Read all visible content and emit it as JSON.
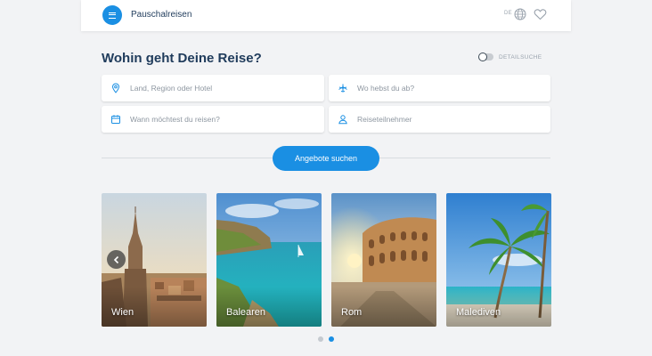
{
  "header": {
    "brand": "Pauschalreisen",
    "language": "DE",
    "icons": [
      "menu-icon",
      "globe-icon",
      "heart-icon"
    ]
  },
  "search": {
    "headline": "Wohin geht Deine Reise?",
    "detail_toggle_label": "DETAILSUCHE",
    "destination_placeholder": "Land, Region oder Hotel",
    "departure_placeholder": "Wo hebst du ab?",
    "dates_placeholder": "Wann möchtest du reisen?",
    "travellers_placeholder": "Reiseteilnehmer",
    "submit_label": "Angebote suchen"
  },
  "destinations": [
    {
      "label": "Wien"
    },
    {
      "label": "Balearen"
    },
    {
      "label": "Rom"
    },
    {
      "label": "Malediven"
    }
  ],
  "carousel": {
    "pages": 2,
    "active_page": 2
  },
  "colors": {
    "accent": "#1a8fe3",
    "heading": "#1f3b5b",
    "background": "#f2f3f5"
  }
}
